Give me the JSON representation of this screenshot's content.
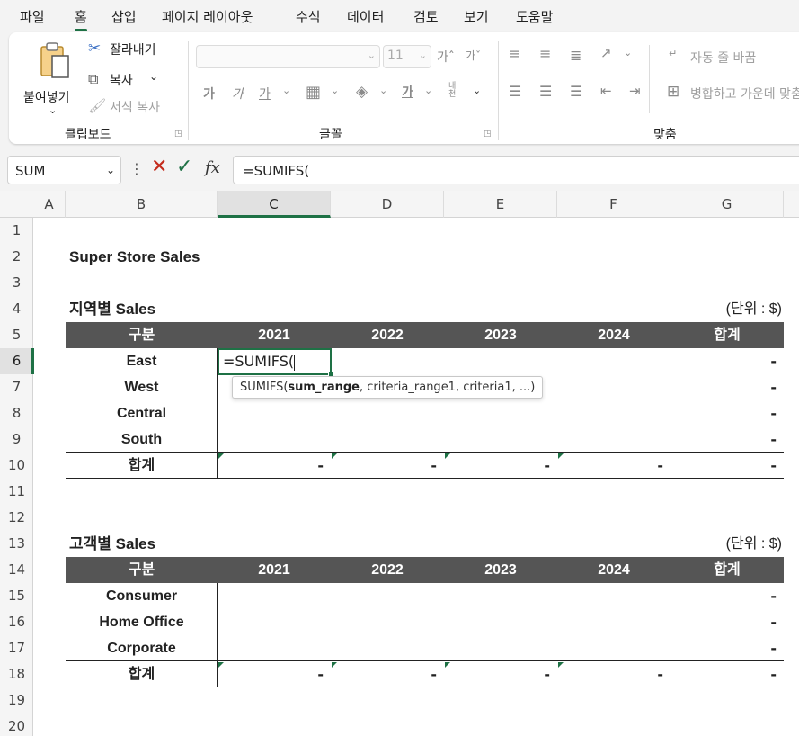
{
  "tabs": [
    "파일",
    "홈",
    "삽입",
    "페이지 레이아웃",
    "수식",
    "데이터",
    "검토",
    "보기",
    "도움말"
  ],
  "active_tab": "홈",
  "ribbon": {
    "clipboard": {
      "paste": "붙여넣기",
      "cut": "잘라내기",
      "copy": "복사",
      "format_painter": "서식 복사",
      "group": "클립보드"
    },
    "font": {
      "font_name": "",
      "font_size": "11",
      "bold": "가",
      "italic": "가",
      "underline": "가",
      "phonetic": "내천",
      "group": "글꼴"
    },
    "alignment": {
      "wrap_text": "자동 줄 바꿈",
      "merge_center": "병합하고 가운데 맞춤",
      "group": "맞춤"
    }
  },
  "formula_bar": {
    "name_box": "SUM",
    "formula": "=SUMIFS("
  },
  "columns": [
    "A",
    "B",
    "C",
    "D",
    "E",
    "F",
    "G"
  ],
  "selected_column": "C",
  "rows": [
    "1",
    "2",
    "3",
    "4",
    "5",
    "6",
    "7",
    "8",
    "9",
    "10",
    "11",
    "12",
    "13",
    "14",
    "15",
    "16",
    "17",
    "18",
    "19",
    "20"
  ],
  "selected_row": "6",
  "sheet": {
    "title": "Super Store Sales",
    "region_table": {
      "title": "지역별 Sales",
      "unit": "(단위 : $)",
      "header": [
        "구분",
        "2021",
        "2022",
        "2023",
        "2024",
        "합계"
      ],
      "rows": [
        "East",
        "West",
        "Central",
        "South"
      ],
      "row_totals": [
        "-",
        "-",
        "-",
        "-"
      ],
      "total_label": "합계",
      "total_values": [
        "-",
        "-",
        "-",
        "-",
        "-"
      ]
    },
    "customer_table": {
      "title": "고객별 Sales",
      "unit": "(단위 : $)",
      "header": [
        "구분",
        "2021",
        "2022",
        "2023",
        "2024",
        "합계"
      ],
      "rows": [
        "Consumer",
        "Home Office",
        "Corporate"
      ],
      "row_totals": [
        "-",
        "-",
        "-"
      ],
      "total_label": "합계",
      "total_values": [
        "-",
        "-",
        "-",
        "-",
        "-"
      ]
    }
  },
  "active_cell": {
    "value": "=SUMIFS("
  },
  "tooltip": {
    "func": "SUMIFS(",
    "arg_bold": "sum_range",
    "rest": ", criteria_range1, criteria1, ...)"
  }
}
